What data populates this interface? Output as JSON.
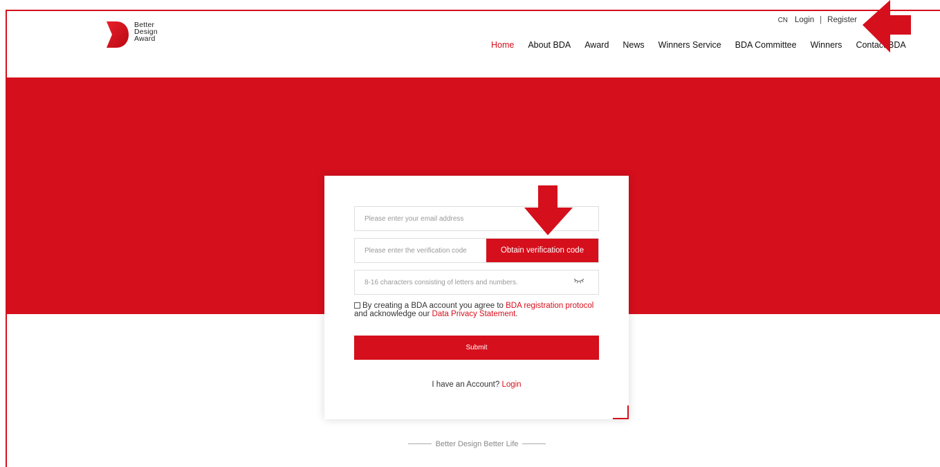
{
  "logo": {
    "line1": "Better",
    "line2": "Design",
    "line3": "Award"
  },
  "topbar": {
    "lang": "CN",
    "login": "Login",
    "separator": "|",
    "register": "Register"
  },
  "nav": {
    "items": [
      {
        "label": "Home",
        "active": true
      },
      {
        "label": "About BDA"
      },
      {
        "label": "Award"
      },
      {
        "label": "News"
      },
      {
        "label": "Winners Service"
      },
      {
        "label": "BDA Committee"
      },
      {
        "label": "Winners"
      },
      {
        "label": "Contact BDA"
      }
    ]
  },
  "form": {
    "email_placeholder": "Please enter your email address",
    "code_placeholder": "Please enter the verification code",
    "code_button": "Obtain verification code",
    "password_placeholder": "8-16 characters consisting of letters and numbers.",
    "eye_icon": "closed-eye-icon",
    "agree_text_1": "By creating a BDA account you agree to ",
    "agree_link_1": "BDA registration protocol",
    "agree_text_2": "and acknowledge our ",
    "agree_link_2": "Data Privacy Statement",
    "agree_text_3": ".",
    "submit_label": "Submit",
    "have_account": "I have an Account?",
    "login_link": "Login"
  },
  "footer": {
    "slogan": "Better Design Better Life"
  },
  "colors": {
    "brand_red": "#d50f1c"
  }
}
